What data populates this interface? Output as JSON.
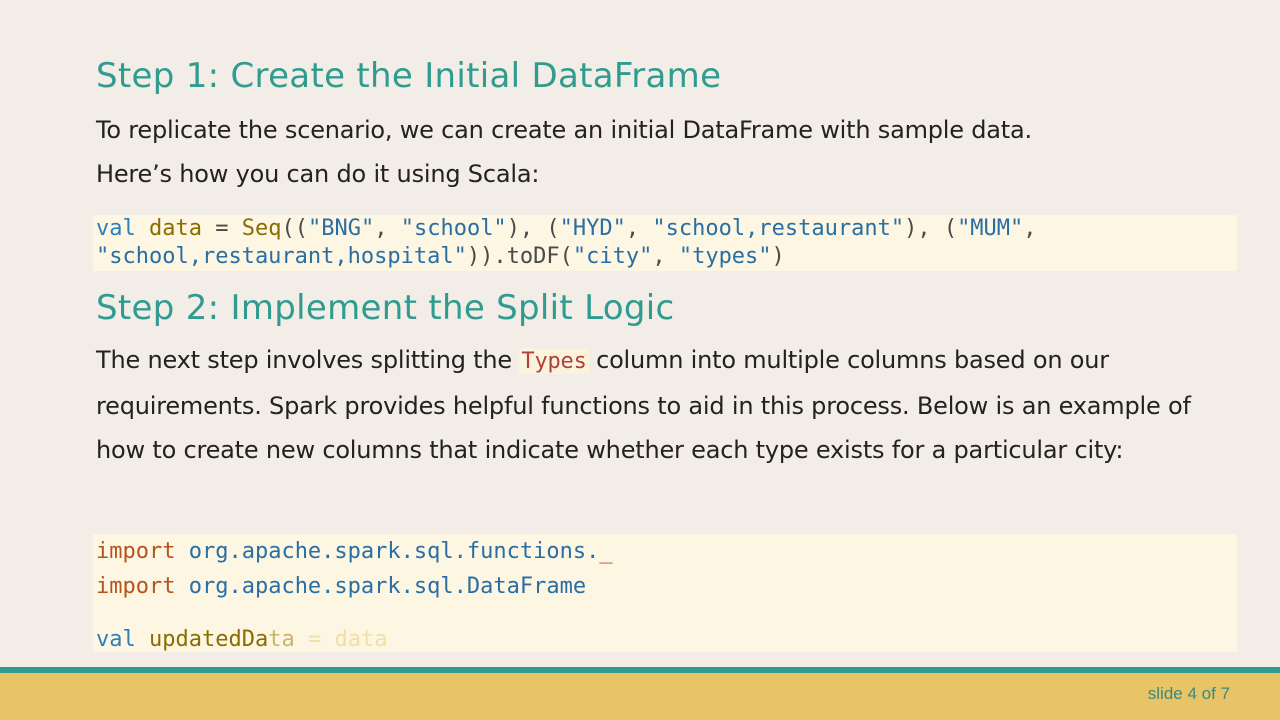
{
  "step1": {
    "heading": "Step 1: Create the Initial DataFrame",
    "para_line1": "To replicate the scenario, we can create an initial DataFrame with sample data.",
    "para_line2": "Here’s how you can do it using Scala:"
  },
  "code1": {
    "kw_val": "val",
    "ident_data": "data",
    "eq": " = ",
    "fn_seq": "Seq",
    "l1_rest_a": "((",
    "s_bng": "\"BNG\"",
    "comma1": ", ",
    "s_school": "\"school\"",
    "l1_rest_b": "), (",
    "s_hyd": "\"HYD\"",
    "comma2": ", ",
    "s_school_rest": "\"school,restaurant\"",
    "l1_rest_c": "), (",
    "s_mum": "\"MUM\"",
    "l1_end": ",",
    "s_school_rest_hosp": "\"school,restaurant,hospital\"",
    "l2_mid": ")).toDF(",
    "s_city": "\"city\"",
    "comma3": ", ",
    "s_types": "\"types\"",
    "l2_end": ")"
  },
  "step2": {
    "heading": "Step 2: Implement the Split Logic",
    "para_before": "The next step involves splitting the ",
    "inline_code": "Types",
    "para_after": " column into multiple columns based on our requirements. Spark provides helpful functions to aid in this process. Below is an example of how to create new columns that indicate whether each type exists for a particular city:"
  },
  "code2": {
    "import_kw": "import",
    "import1_pkg": " org.apache.spark.sql.functions.",
    "import1_underscore": "_",
    "import2_pkg": " org.apache.spark.sql.DataFrame",
    "kw_val": "val",
    "ident_visible": "updatedDa",
    "ident_faded": "ta",
    "faded_rest": " = data"
  },
  "footer": {
    "slide_label": "slide 4 of 7"
  },
  "colors": {
    "heading": "#2f9c8f",
    "footer_band": "#e8c467",
    "teal_rule": "#2e9c91",
    "code_bg": "#fcf6e3"
  }
}
